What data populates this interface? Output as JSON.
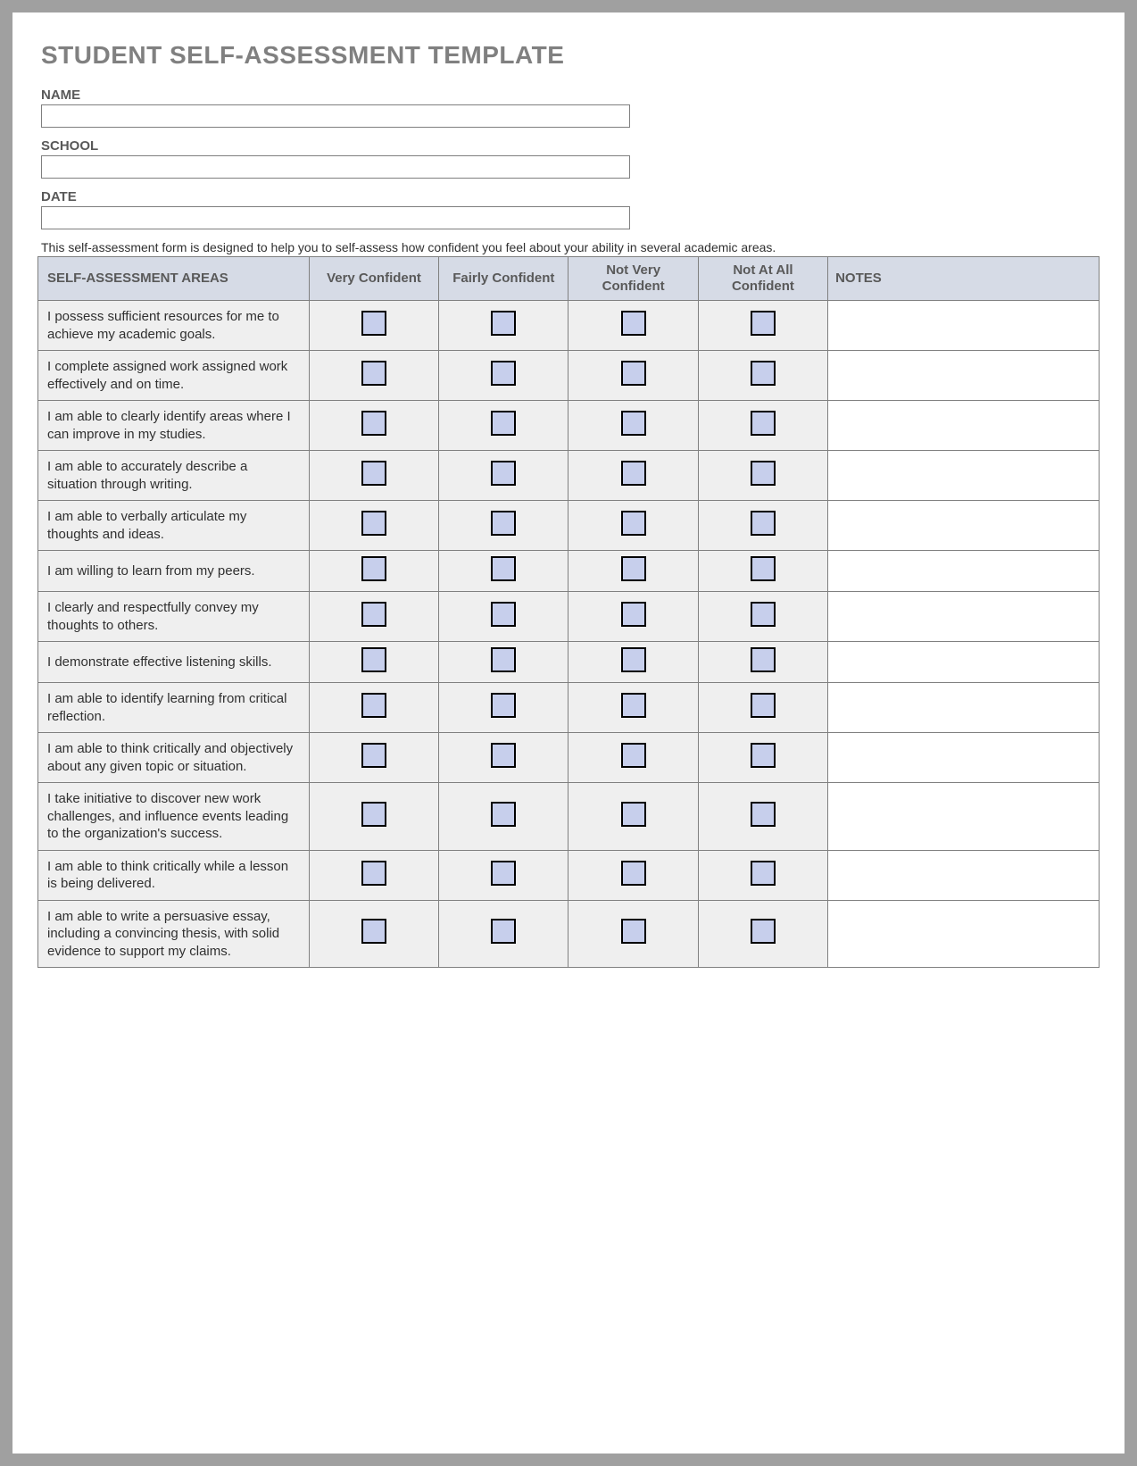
{
  "title": "STUDENT SELF-ASSESSMENT TEMPLATE",
  "fields": {
    "name_label": "NAME",
    "name_value": "",
    "school_label": "SCHOOL",
    "school_value": "",
    "date_label": "DATE",
    "date_value": ""
  },
  "intro": "This self-assessment form is designed to help you to self-assess how confident you feel about your ability in several academic areas.",
  "headers": {
    "areas": "SELF-ASSESSMENT AREAS",
    "rating1": "Very Confident",
    "rating2": "Fairly Confident",
    "rating3": "Not Very Confident",
    "rating4": "Not At All Confident",
    "notes": "NOTES"
  },
  "rows": [
    {
      "area": "I possess sufficient resources for me to achieve my academic goals.",
      "notes": ""
    },
    {
      "area": "I complete assigned work assigned work effectively and on time.",
      "notes": ""
    },
    {
      "area": "I am able to clearly identify areas where I can improve in my studies.",
      "notes": ""
    },
    {
      "area": "I am able to accurately describe a situation through writing.",
      "notes": ""
    },
    {
      "area": "I am able to verbally articulate my thoughts and ideas.",
      "notes": ""
    },
    {
      "area": "I am willing to learn from my peers.",
      "notes": ""
    },
    {
      "area": "I clearly and respectfully convey my thoughts to others.",
      "notes": ""
    },
    {
      "area": "I demonstrate effective listening skills.",
      "notes": ""
    },
    {
      "area": "I am able to identify learning from critical reflection.",
      "notes": ""
    },
    {
      "area": "I am able to think critically and objectively about any given topic or situation.",
      "notes": ""
    },
    {
      "area": "I take initiative to discover new work challenges, and influence events leading to the organization's success.",
      "notes": ""
    },
    {
      "area": "I am able to think critically while a lesson is being delivered.",
      "notes": ""
    },
    {
      "area": "I am able to write a persuasive essay, including a convincing thesis, with solid evidence to support my claims.",
      "notes": ""
    }
  ]
}
